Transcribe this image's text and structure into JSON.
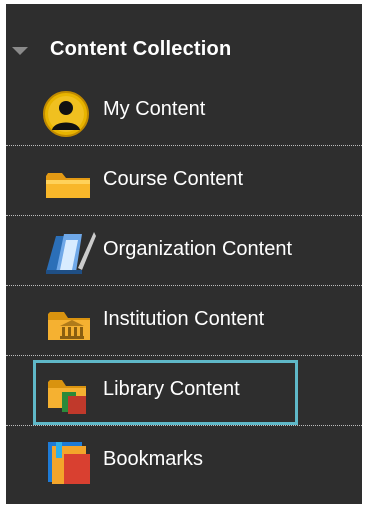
{
  "panel": {
    "header": {
      "title": "Content Collection",
      "caret_icon": "caret-down-icon"
    },
    "items": [
      {
        "label": "My Content",
        "icon": "user-avatar-icon"
      },
      {
        "label": "Course Content",
        "icon": "folder-icon"
      },
      {
        "label": "Organization Content",
        "icon": "organization-books-icon"
      },
      {
        "label": "Institution Content",
        "icon": "institution-folder-icon"
      },
      {
        "label": "Library Content",
        "icon": "library-folder-icon",
        "highlighted": true
      },
      {
        "label": "Bookmarks",
        "icon": "bookmarks-icon"
      }
    ],
    "colors": {
      "background": "#2e2e2e",
      "text": "#ffffff",
      "highlight": "#5fb8c8",
      "divider": "#bdbdbd"
    }
  }
}
